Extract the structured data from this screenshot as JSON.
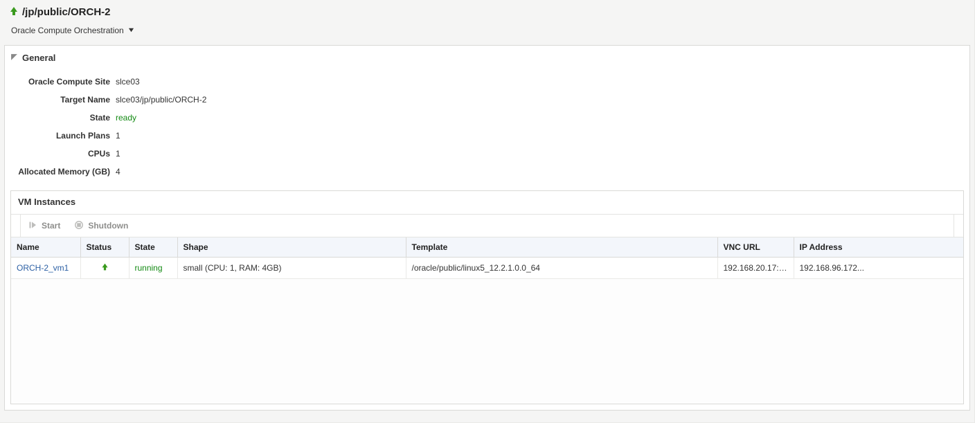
{
  "header": {
    "title": "/jp/public/ORCH-2",
    "subtitle": "Oracle Compute Orchestration"
  },
  "general": {
    "section_title": "General",
    "rows": [
      {
        "label": "Oracle Compute Site",
        "value": "slce03"
      },
      {
        "label": "Target Name",
        "value": "slce03/jp/public/ORCH-2"
      },
      {
        "label": "State",
        "value": "ready",
        "green": true
      },
      {
        "label": "Launch Plans",
        "value": "1"
      },
      {
        "label": "CPUs",
        "value": "1"
      },
      {
        "label": "Allocated Memory (GB)",
        "value": "4"
      }
    ]
  },
  "vm": {
    "title": "VM Instances",
    "toolbar": {
      "start": "Start",
      "shutdown": "Shutdown"
    },
    "columns": [
      "Name",
      "Status",
      "State",
      "Shape",
      "Template",
      "VNC URL",
      "IP Address"
    ],
    "rows": [
      {
        "name": "ORCH-2_vm1",
        "status": "up",
        "state": "running",
        "shape": "small (CPU: 1, RAM: 4GB)",
        "template": "/oracle/public/linux5_12.2.1.0.0_64",
        "vnc_url": "192.168.20.17:5...",
        "ip": "192.168.96.172..."
      }
    ]
  },
  "colors": {
    "status_green": "#3a9a1e",
    "link_blue": "#2b5fa4"
  }
}
